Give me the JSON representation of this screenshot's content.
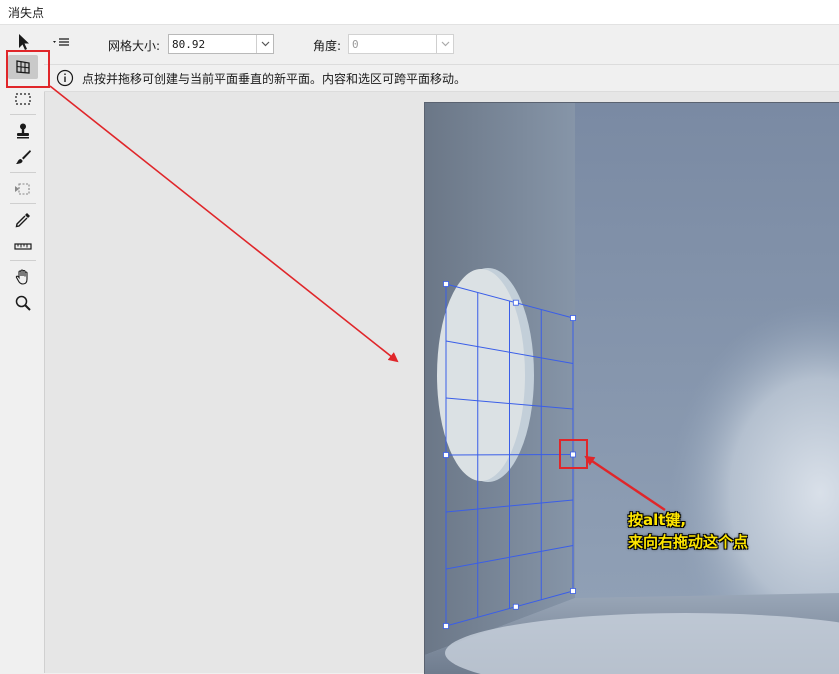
{
  "window": {
    "title": "消失点"
  },
  "tools": [
    {
      "name": "edit-plane-tool-icon"
    },
    {
      "name": "create-plane-tool-icon",
      "active": true
    },
    {
      "name": "marquee-tool-icon"
    },
    {
      "name": "stamp-tool-icon"
    },
    {
      "name": "brush-tool-icon"
    },
    {
      "name": "transform-tool-icon"
    },
    {
      "name": "eyedropper-tool-icon"
    },
    {
      "name": "measure-tool-icon"
    },
    {
      "name": "hand-tool-icon"
    },
    {
      "name": "zoom-tool-icon"
    }
  ],
  "options": {
    "grid_size_label": "网格大小:",
    "grid_size_value": "80.92",
    "angle_label": "角度:",
    "angle_value": "0"
  },
  "info": {
    "message": "点按并拖移可创建与当前平面垂直的新平面。内容和选区可跨平面移动。"
  },
  "annotation": {
    "line1": "按alt键,",
    "line2": "来向右拖动这个点"
  },
  "colors": {
    "annotation_red": "#e0262a",
    "grid_blue": "#3a5ee8",
    "hint_yellow": "#ffe600"
  }
}
